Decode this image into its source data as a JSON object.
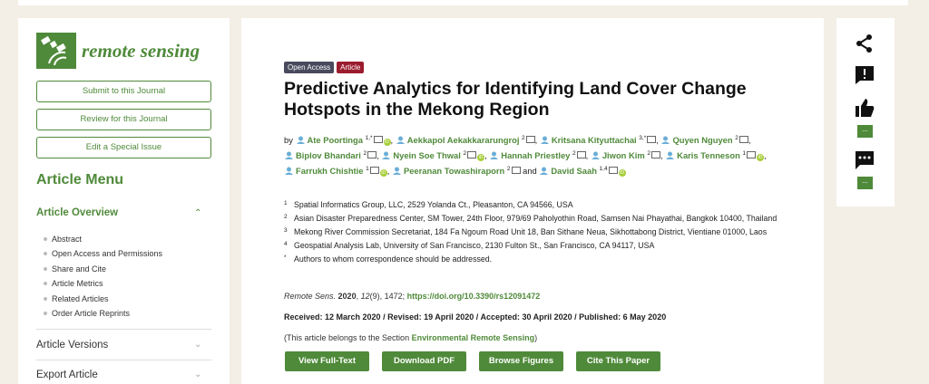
{
  "sidebar": {
    "journal_name": "remote sensing",
    "buttons": [
      "Submit to this Journal",
      "Review for this Journal",
      "Edit a Special Issue"
    ],
    "menu_title": "Article Menu",
    "overview_label": "Article Overview",
    "overview_items": [
      "Abstract",
      "Open Access and Permissions",
      "Share and Cite",
      "Article Metrics",
      "Related Articles",
      "Order Article Reprints"
    ],
    "versions_label": "Article Versions",
    "export_label": "Export Article"
  },
  "article": {
    "badges": [
      "Open Access",
      "Article"
    ],
    "title": "Predictive Analytics for Identifying Land Cover Change Hotspots in the Mekong Region",
    "by": "by",
    "and": "and",
    "authors": [
      {
        "name": "Ate Poortinga",
        "sup": "1,*"
      },
      {
        "name": "Aekkapol Aekakkararungroj",
        "sup": "2"
      },
      {
        "name": "Kritsana Kityuttachai",
        "sup": "3,*"
      },
      {
        "name": "Quyen Nguyen",
        "sup": "2"
      },
      {
        "name": "Biplov Bhandari",
        "sup": "2"
      },
      {
        "name": "Nyein Soe Thwal",
        "sup": "2"
      },
      {
        "name": "Hannah Priestley",
        "sup": "2"
      },
      {
        "name": "Jiwon Kim",
        "sup": "2"
      },
      {
        "name": "Karis Tenneson",
        "sup": "1"
      },
      {
        "name": "Farrukh Chishtie",
        "sup": "1"
      },
      {
        "name": "Peeranan Towashiraporn",
        "sup": "2"
      },
      {
        "name": "David Saah",
        "sup": "1,4"
      }
    ],
    "affiliations": [
      {
        "num": "1",
        "text": "Spatial Informatics Group, LLC, 2529 Yolanda Ct., Pleasanton, CA 94566, USA"
      },
      {
        "num": "2",
        "text": "Asian Disaster Preparedness Center, SM Tower, 24th Floor, 979/69 Paholyothin Road, Samsen Nai Phayathai, Bangkok 10400, Thailand"
      },
      {
        "num": "3",
        "text": "Mekong River Commission Secretariat, 184 Fa Ngoum Road Unit 18, Ban Sithane Neua, Sikhottabong District, Vientiane 01000, Laos"
      },
      {
        "num": "4",
        "text": "Geospatial Analysis Lab, University of San Francisco, 2130 Fulton St., San Francisco, CA 94117, USA"
      },
      {
        "num": "*",
        "text": "Authors to whom correspondence should be addressed."
      }
    ],
    "citation": {
      "journal": "Remote Sens.",
      "year": "2020",
      "volume": "12",
      "issue_pages": "(9), 1472;",
      "doi": "https://doi.org/10.3390/rs12091472"
    },
    "dates": "Received: 12 March 2020 / Revised: 19 April 2020 / Accepted: 30 April 2020 / Published: 6 May 2020",
    "section_prefix": "(This article belongs to the Section ",
    "section_name": "Environmental Remote Sensing",
    "section_suffix": ")",
    "actions": [
      "View Full-Text",
      "Download PDF",
      "Browse Figures",
      "Cite This Paper"
    ]
  },
  "toolbar": {
    "icons": [
      "share-icon",
      "report-icon",
      "thumbs-up-icon",
      "comment-icon"
    ],
    "pill_label": "..."
  },
  "colors": {
    "accent": "#4f8a3a",
    "article_badge": "#9b1c2e",
    "open_access_badge": "#4a4a5e"
  }
}
